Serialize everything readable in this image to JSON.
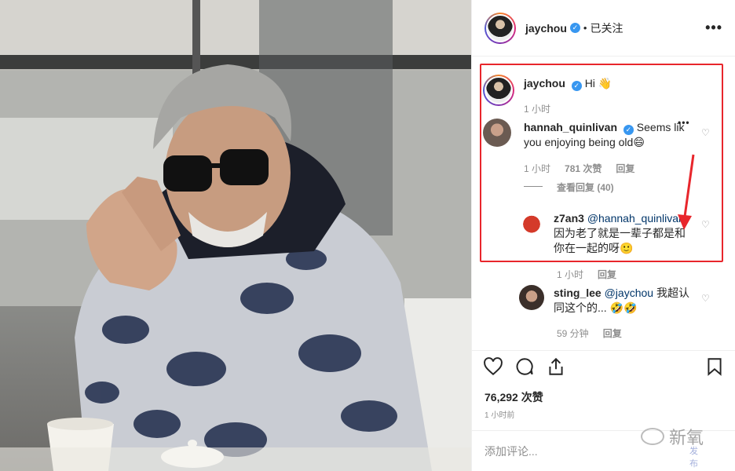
{
  "post": {
    "username": "jaychou",
    "follow_status": "已关注",
    "more_label": "•••",
    "likes": "76,292 次赞",
    "time": "1 小时前",
    "add_comment_placeholder": "添加评论..."
  },
  "comments": [
    {
      "username": "jaychou",
      "text": "Hi 👋",
      "time": "1 小时",
      "verified": true
    },
    {
      "username": "hannah_quinlivan",
      "text_line1": "Seems lik",
      "text_line2": "you enjoying being old😄",
      "time": "1 小时",
      "likes": "781 次赞",
      "reply_label": "回复",
      "view_replies": "查看回复 (40)",
      "verified": true
    },
    {
      "username": "z7an3",
      "mention": "@hannah_quinlivan",
      "text_line1": "因为老了就是一辈子都是和",
      "text_line2": "你在一起的呀🙂",
      "time": "1 小时",
      "reply_label": "回复"
    },
    {
      "username": "sting_lee",
      "mention": "@jaychou",
      "text_line1": " 我超认",
      "text_line2": "同这个的... 🤣🤣",
      "time": "59 分钟",
      "reply_label": "回复"
    }
  ],
  "watermark": {
    "brand": "新氧",
    "sub": "发布"
  },
  "icons": {
    "heart": "heart-icon",
    "comment": "comment-icon",
    "share": "share-icon",
    "bookmark": "bookmark-icon",
    "more": "more-icon",
    "verified": "verified-badge-icon"
  },
  "colors": {
    "highlight_box": "#e8262c",
    "verified": "#3897f0",
    "mention": "#003569",
    "muted": "#8e8e8e"
  }
}
